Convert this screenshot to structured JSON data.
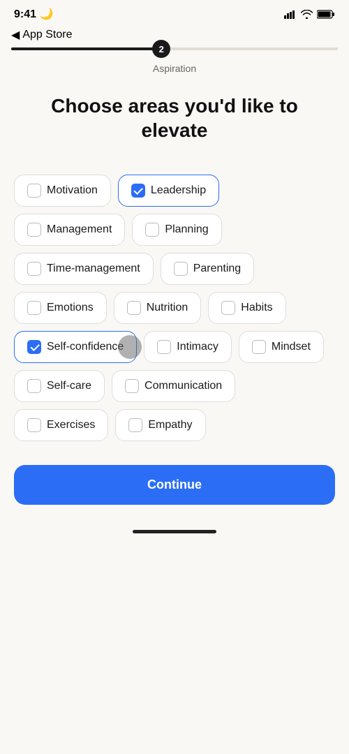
{
  "statusBar": {
    "time": "9:41",
    "moonIcon": "🌙"
  },
  "nav": {
    "backLabel": "App Store"
  },
  "progress": {
    "step": "2",
    "label": "Aspiration",
    "fillPercent": 46
  },
  "header": {
    "title": "Choose areas you'd like to elevate"
  },
  "options": [
    {
      "id": "motivation",
      "label": "Motivation",
      "selected": false
    },
    {
      "id": "leadership",
      "label": "Leadership",
      "selected": true
    },
    {
      "id": "management",
      "label": "Management",
      "selected": false
    },
    {
      "id": "planning",
      "label": "Planning",
      "selected": false
    },
    {
      "id": "time-management",
      "label": "Time-management",
      "selected": false
    },
    {
      "id": "parenting",
      "label": "Parenting",
      "selected": false
    },
    {
      "id": "emotions",
      "label": "Emotions",
      "selected": false
    },
    {
      "id": "nutrition",
      "label": "Nutrition",
      "selected": false
    },
    {
      "id": "habits",
      "label": "Habits",
      "selected": false
    },
    {
      "id": "self-confidence",
      "label": "Self-confidence",
      "selected": true,
      "hasFinger": true
    },
    {
      "id": "intimacy",
      "label": "Intimacy",
      "selected": false
    },
    {
      "id": "mindset",
      "label": "Mindset",
      "selected": false
    },
    {
      "id": "self-care",
      "label": "Self-care",
      "selected": false
    },
    {
      "id": "communication",
      "label": "Communication",
      "selected": false
    },
    {
      "id": "exercises",
      "label": "Exercises",
      "selected": false
    },
    {
      "id": "empathy",
      "label": "Empathy",
      "selected": false
    }
  ],
  "continueBtn": {
    "label": "Continue"
  }
}
